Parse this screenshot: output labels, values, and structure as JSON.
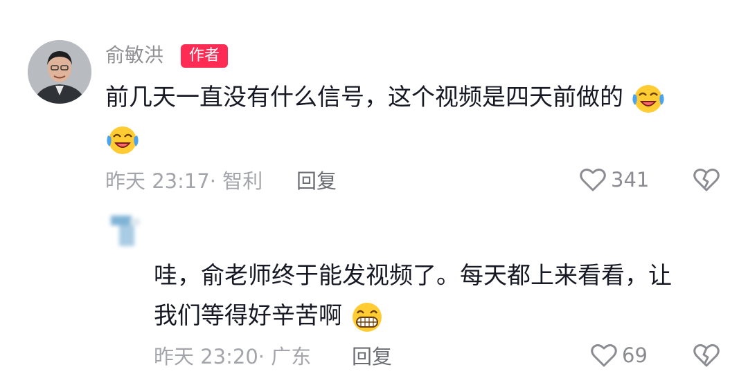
{
  "comment1": {
    "author": "俞敏洪",
    "author_badge": "作者",
    "text": "前几天一直没有什么信号，这个视频是四天前做的",
    "emojis": [
      "laughing-crying-emoji",
      "laughing-crying-emoji"
    ],
    "time_location": "昨天 23:17· 智利",
    "reply_label": "回复",
    "like_count": "341"
  },
  "reply1": {
    "author": "",
    "text_line1": "哇，俞老师终于能发视频了。每天都上来看看，让",
    "text_line2": "我们等得好辛苦啊",
    "emojis": [
      "grinning-emoji"
    ],
    "time_location": "昨天 23:20· 广东",
    "reply_label": "回复",
    "like_count": "69"
  },
  "colors": {
    "badge": "#fe2c55",
    "text": "#161823",
    "meta": "#a3a5ab"
  }
}
